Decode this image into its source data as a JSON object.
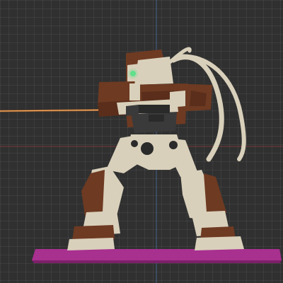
{
  "viewport": {
    "background": "#303030",
    "grid_color": "#3d3d3d",
    "axis_y_color": "#4a6fa5",
    "axis_x_color": "#8a3a3a"
  },
  "scene": {
    "subject": "mech-robot",
    "laser_color": "#ff7a1a",
    "platform_color": "#a8308f",
    "armor_brown": "#6e3a22",
    "frame_cream": "#d9d0bb",
    "joint_dark": "#2a2a2a",
    "eye_glow": "#5fe08a"
  }
}
